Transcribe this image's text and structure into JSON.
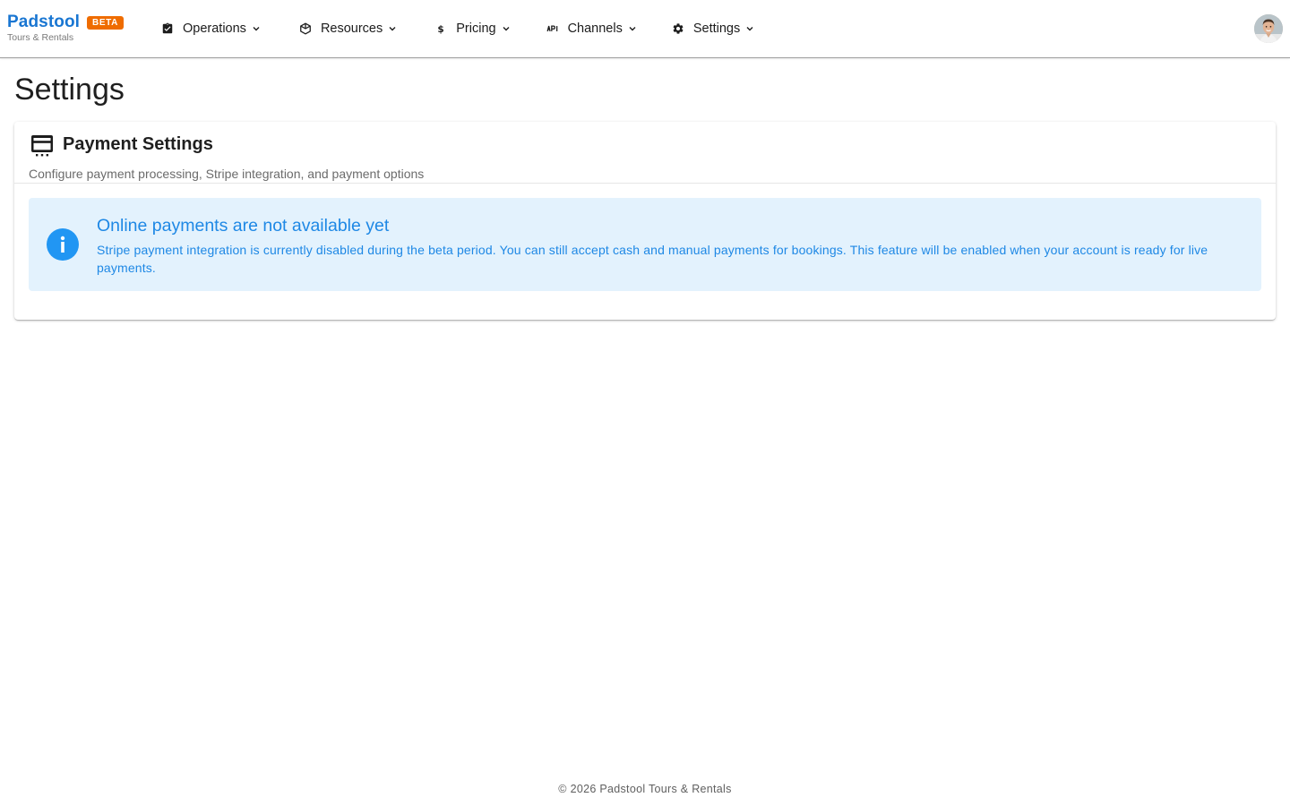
{
  "brand": {
    "name": "Padstool",
    "badge": "BETA",
    "tagline": "Tours & Rentals"
  },
  "nav": {
    "items": [
      {
        "label": "Operations",
        "icon": "clipboard-check-icon"
      },
      {
        "label": "Resources",
        "icon": "cube-icon"
      },
      {
        "label": "Pricing",
        "icon": "dollar-icon"
      },
      {
        "label": "Channels",
        "icon": "api-icon"
      },
      {
        "label": "Settings",
        "icon": "gear-icon"
      }
    ]
  },
  "user": {
    "avatar": "user-avatar"
  },
  "page": {
    "title": "Settings"
  },
  "card": {
    "icon": "payment-card-icon",
    "title": "Payment Settings",
    "subtitle": "Configure payment processing, Stripe integration, and payment options",
    "alert": {
      "icon": "info-icon",
      "title": "Online payments are not available yet",
      "body": "Stripe payment integration is currently disabled during the beta period. You can still accept cash and manual payments for bookings. This feature will be enabled when your account is ready for live payments."
    }
  },
  "footer": {
    "text": "© 2026 Padstool Tours & Rentals"
  },
  "colors": {
    "brand": "#1976d2",
    "badge": "#ef6c00",
    "info_bg": "#e3f2fd",
    "info_fg": "#1e88e5",
    "info_icon": "#2196f3"
  }
}
